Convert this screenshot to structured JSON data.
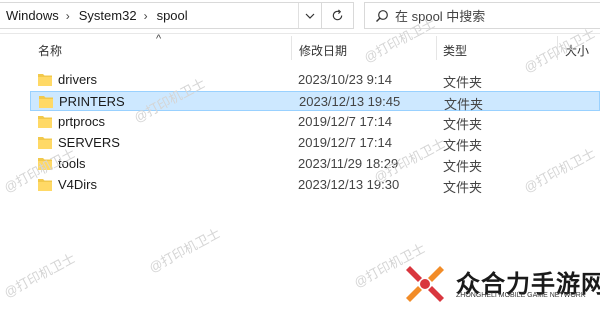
{
  "address": {
    "crumbs": [
      "Windows",
      "System32",
      "spool"
    ],
    "dropdown_icon": "chevron-down-icon",
    "refresh_icon": "refresh-icon"
  },
  "search": {
    "placeholder": "在 spool 中搜索",
    "icon": "search-icon"
  },
  "columns": {
    "name": "名称",
    "date": "修改日期",
    "type": "类型",
    "size": "大小"
  },
  "files": [
    {
      "name": "drivers",
      "date": "2023/10/23 9:14",
      "type": "文件夹",
      "selected": false
    },
    {
      "name": "PRINTERS",
      "date": "2023/12/13 19:45",
      "type": "文件夹",
      "selected": true
    },
    {
      "name": "prtprocs",
      "date": "2019/12/7 17:14",
      "type": "文件夹",
      "selected": false
    },
    {
      "name": "SERVERS",
      "date": "2019/12/7 17:14",
      "type": "文件夹",
      "selected": false
    },
    {
      "name": "tools",
      "date": "2023/11/29 18:29",
      "type": "文件夹",
      "selected": false
    },
    {
      "name": "V4Dirs",
      "date": "2023/12/13 19:30",
      "type": "文件夹",
      "selected": false
    }
  ],
  "watermark": "@打印机卫士",
  "brand": {
    "title": "众合力手游网",
    "subtitle": "ZHONGHELI MOBILE GAME NETWORK"
  },
  "colors": {
    "selection": "#cde8ff",
    "selection_border": "#99d1ff",
    "folder": "#f2c94c",
    "brand_accent": "#d9363e"
  }
}
